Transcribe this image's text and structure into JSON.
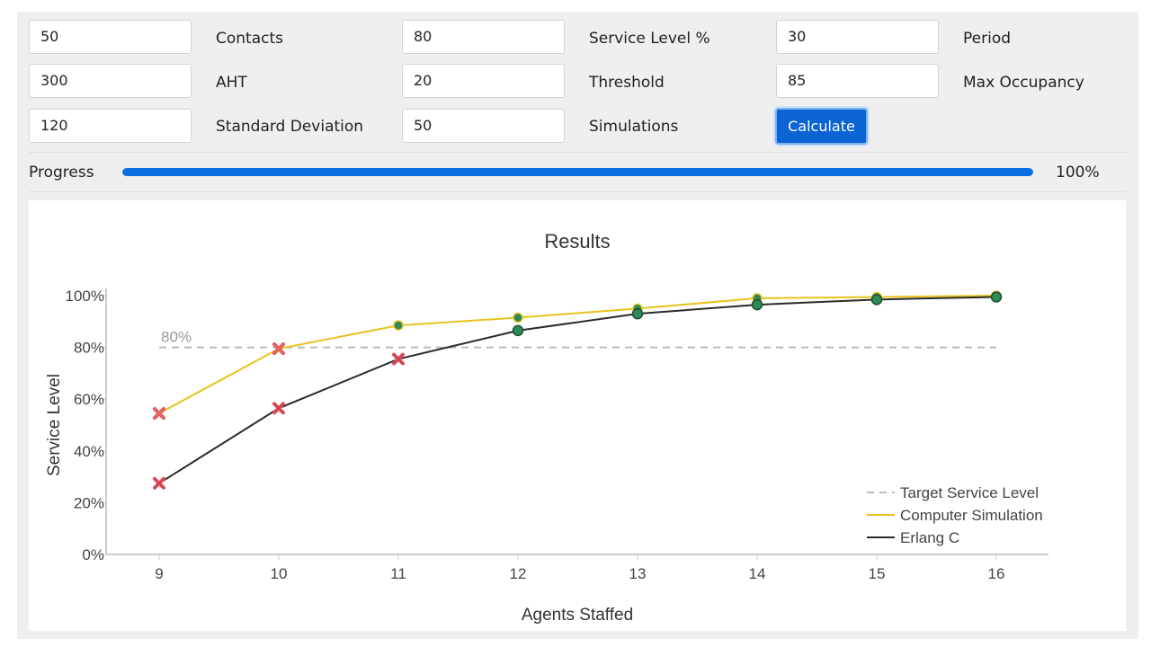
{
  "form": {
    "contacts": {
      "value": "50",
      "label": "Contacts"
    },
    "service_level": {
      "value": "80",
      "label": "Service Level %"
    },
    "period": {
      "value": "30",
      "label": "Period"
    },
    "aht": {
      "value": "300",
      "label": "AHT"
    },
    "threshold": {
      "value": "20",
      "label": "Threshold"
    },
    "max_occupancy": {
      "value": "85",
      "label": "Max Occupancy"
    },
    "std_dev": {
      "value": "120",
      "label": "Standard Deviation"
    },
    "simulations": {
      "value": "50",
      "label": "Simulations"
    },
    "calculate_label": "Calculate"
  },
  "progress": {
    "label": "Progress",
    "value": 1.0,
    "text": "100%"
  },
  "chart_data": {
    "type": "line",
    "title": "Results",
    "xlabel": "Agents Staffed",
    "ylabel": "Service Level",
    "x": [
      9,
      10,
      11,
      12,
      13,
      14,
      15,
      16
    ],
    "ylim": [
      0,
      100
    ],
    "yticks": [
      "0%",
      "20%",
      "40%",
      "60%",
      "80%",
      "100%"
    ],
    "target": {
      "name": "Target Service Level",
      "value": 80,
      "label": "80%",
      "color": "#bbbbbb"
    },
    "series": [
      {
        "name": "Computer Simulation",
        "color": "#e8c21e",
        "values": [
          54.5,
          79.5,
          88.5,
          91.5,
          95,
          99,
          99.5,
          100
        ]
      },
      {
        "name": "Erlang C",
        "color": "#2b2b2b",
        "values": [
          27.5,
          56.5,
          75.5,
          86.5,
          93,
          96.5,
          98.5,
          99.5
        ]
      }
    ],
    "marker_pass_color": "#2e8b57",
    "marker_fail_color": "#e05060",
    "legend": "bottom-right",
    "grid": false
  }
}
